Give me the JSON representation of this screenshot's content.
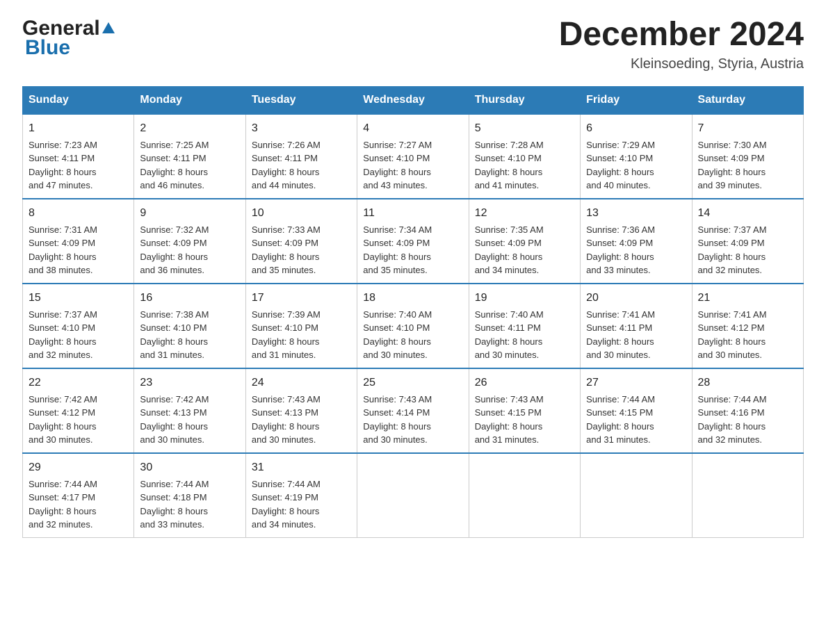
{
  "header": {
    "logo": {
      "general": "General",
      "blue": "Blue"
    },
    "title": "December 2024",
    "location": "Kleinsoeding, Styria, Austria"
  },
  "calendar": {
    "days": [
      "Sunday",
      "Monday",
      "Tuesday",
      "Wednesday",
      "Thursday",
      "Friday",
      "Saturday"
    ],
    "weeks": [
      [
        {
          "date": "1",
          "sunrise": "7:23 AM",
          "sunset": "4:11 PM",
          "daylight": "8 hours and 47 minutes."
        },
        {
          "date": "2",
          "sunrise": "7:25 AM",
          "sunset": "4:11 PM",
          "daylight": "8 hours and 46 minutes."
        },
        {
          "date": "3",
          "sunrise": "7:26 AM",
          "sunset": "4:11 PM",
          "daylight": "8 hours and 44 minutes."
        },
        {
          "date": "4",
          "sunrise": "7:27 AM",
          "sunset": "4:10 PM",
          "daylight": "8 hours and 43 minutes."
        },
        {
          "date": "5",
          "sunrise": "7:28 AM",
          "sunset": "4:10 PM",
          "daylight": "8 hours and 41 minutes."
        },
        {
          "date": "6",
          "sunrise": "7:29 AM",
          "sunset": "4:10 PM",
          "daylight": "8 hours and 40 minutes."
        },
        {
          "date": "7",
          "sunrise": "7:30 AM",
          "sunset": "4:09 PM",
          "daylight": "8 hours and 39 minutes."
        }
      ],
      [
        {
          "date": "8",
          "sunrise": "7:31 AM",
          "sunset": "4:09 PM",
          "daylight": "8 hours and 38 minutes."
        },
        {
          "date": "9",
          "sunrise": "7:32 AM",
          "sunset": "4:09 PM",
          "daylight": "8 hours and 36 minutes."
        },
        {
          "date": "10",
          "sunrise": "7:33 AM",
          "sunset": "4:09 PM",
          "daylight": "8 hours and 35 minutes."
        },
        {
          "date": "11",
          "sunrise": "7:34 AM",
          "sunset": "4:09 PM",
          "daylight": "8 hours and 35 minutes."
        },
        {
          "date": "12",
          "sunrise": "7:35 AM",
          "sunset": "4:09 PM",
          "daylight": "8 hours and 34 minutes."
        },
        {
          "date": "13",
          "sunrise": "7:36 AM",
          "sunset": "4:09 PM",
          "daylight": "8 hours and 33 minutes."
        },
        {
          "date": "14",
          "sunrise": "7:37 AM",
          "sunset": "4:09 PM",
          "daylight": "8 hours and 32 minutes."
        }
      ],
      [
        {
          "date": "15",
          "sunrise": "7:37 AM",
          "sunset": "4:10 PM",
          "daylight": "8 hours and 32 minutes."
        },
        {
          "date": "16",
          "sunrise": "7:38 AM",
          "sunset": "4:10 PM",
          "daylight": "8 hours and 31 minutes."
        },
        {
          "date": "17",
          "sunrise": "7:39 AM",
          "sunset": "4:10 PM",
          "daylight": "8 hours and 31 minutes."
        },
        {
          "date": "18",
          "sunrise": "7:40 AM",
          "sunset": "4:10 PM",
          "daylight": "8 hours and 30 minutes."
        },
        {
          "date": "19",
          "sunrise": "7:40 AM",
          "sunset": "4:11 PM",
          "daylight": "8 hours and 30 minutes."
        },
        {
          "date": "20",
          "sunrise": "7:41 AM",
          "sunset": "4:11 PM",
          "daylight": "8 hours and 30 minutes."
        },
        {
          "date": "21",
          "sunrise": "7:41 AM",
          "sunset": "4:12 PM",
          "daylight": "8 hours and 30 minutes."
        }
      ],
      [
        {
          "date": "22",
          "sunrise": "7:42 AM",
          "sunset": "4:12 PM",
          "daylight": "8 hours and 30 minutes."
        },
        {
          "date": "23",
          "sunrise": "7:42 AM",
          "sunset": "4:13 PM",
          "daylight": "8 hours and 30 minutes."
        },
        {
          "date": "24",
          "sunrise": "7:43 AM",
          "sunset": "4:13 PM",
          "daylight": "8 hours and 30 minutes."
        },
        {
          "date": "25",
          "sunrise": "7:43 AM",
          "sunset": "4:14 PM",
          "daylight": "8 hours and 30 minutes."
        },
        {
          "date": "26",
          "sunrise": "7:43 AM",
          "sunset": "4:15 PM",
          "daylight": "8 hours and 31 minutes."
        },
        {
          "date": "27",
          "sunrise": "7:44 AM",
          "sunset": "4:15 PM",
          "daylight": "8 hours and 31 minutes."
        },
        {
          "date": "28",
          "sunrise": "7:44 AM",
          "sunset": "4:16 PM",
          "daylight": "8 hours and 32 minutes."
        }
      ],
      [
        {
          "date": "29",
          "sunrise": "7:44 AM",
          "sunset": "4:17 PM",
          "daylight": "8 hours and 32 minutes."
        },
        {
          "date": "30",
          "sunrise": "7:44 AM",
          "sunset": "4:18 PM",
          "daylight": "8 hours and 33 minutes."
        },
        {
          "date": "31",
          "sunrise": "7:44 AM",
          "sunset": "4:19 PM",
          "daylight": "8 hours and 34 minutes."
        },
        null,
        null,
        null,
        null
      ]
    ],
    "labels": {
      "sunrise": "Sunrise:",
      "sunset": "Sunset:",
      "daylight": "Daylight:"
    }
  }
}
